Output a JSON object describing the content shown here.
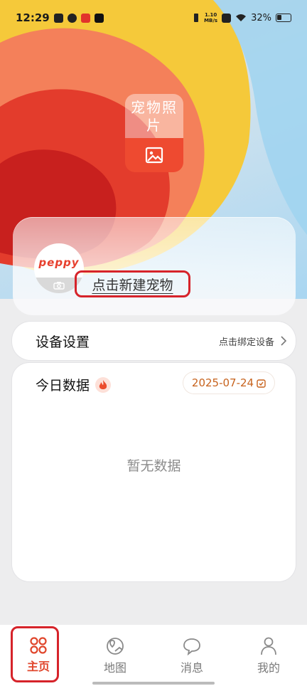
{
  "status_bar": {
    "time": "12:29",
    "net_speed_value": "1.10",
    "net_speed_unit": "MB/s",
    "battery": "32%"
  },
  "hero": {
    "pet_photo_label": "宠物照片",
    "pet_photo_icon": "image-icon"
  },
  "profile": {
    "avatar_logo": "peppy",
    "new_pet_label": "点击新建宠物"
  },
  "device": {
    "title": "设备设置",
    "bind_label": "点击绑定设备"
  },
  "today_data": {
    "title": "今日数据",
    "date": "2025-07-24",
    "empty_text": "暂无数据"
  },
  "tabs": [
    {
      "label": "主页",
      "icon": "home-grid-icon",
      "active": true
    },
    {
      "label": "地图",
      "icon": "map-pin-icon",
      "active": false
    },
    {
      "label": "消息",
      "icon": "chat-bubble-icon",
      "active": false
    },
    {
      "label": "我的",
      "icon": "user-icon",
      "active": false
    }
  ],
  "colors": {
    "accent": "#e0462c",
    "highlight_box": "#d6232a",
    "date_text": "#c7621c"
  }
}
